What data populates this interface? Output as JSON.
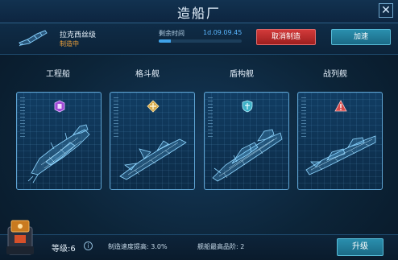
{
  "window": {
    "title": "造船厂",
    "corner_text": "",
    "close_icon": "close-icon"
  },
  "production": {
    "ship_name": "拉克西丝级",
    "status": "制造中",
    "remaining_label": "剩余时间",
    "remaining_time": "1d.09.09.45",
    "progress": 0.15,
    "cancel_label": "取消制造",
    "speedup_label": "加速"
  },
  "categories": [
    {
      "label": "工程船",
      "icon": "engineering-icon",
      "icon_color": "#a14bd6"
    },
    {
      "label": "格斗舰",
      "icon": "fighter-icon",
      "icon_color": "#d6a94b"
    },
    {
      "label": "盾构舰",
      "icon": "shield-icon",
      "icon_color": "#3fb0c6"
    },
    {
      "label": "战列舰",
      "icon": "warning-icon",
      "icon_color": "#d64b4b"
    }
  ],
  "footer": {
    "level": "等级:6",
    "speed_text": "制造速度提高: 3.0%",
    "rank_text": "舰船最高品阶: 2",
    "upgrade_label": "升级"
  },
  "colors": {
    "accent": "#3fa3ea",
    "cancel": "#c02f2f",
    "status": "#f0a23a"
  }
}
